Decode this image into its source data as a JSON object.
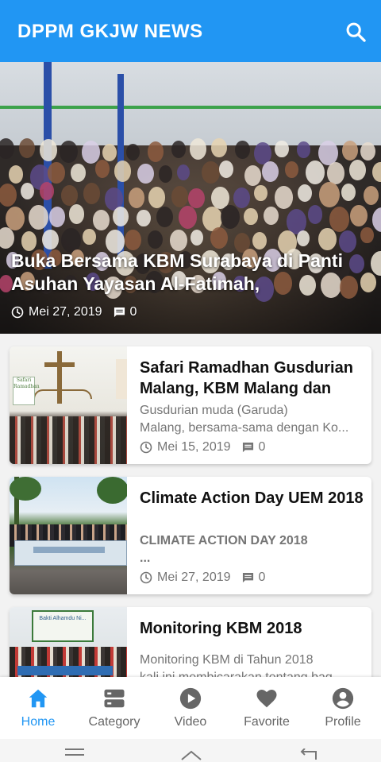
{
  "app": {
    "title": "DPPM GKJW NEWS",
    "search_icon": "search-icon"
  },
  "featured": {
    "title": "Buka Bersama KBM Surabaya di Panti Asuhan Yayasan Al-Fatimah,",
    "date": "Mei 27, 2019",
    "comments": "0"
  },
  "articles": [
    {
      "title": "Safari Ramadhan Gusdurian Malang, KBM Malang dan",
      "desc_line1": "Gusdurian muda (Garuda)",
      "desc_line2": "Malang, bersama-sama dengan Ko...",
      "date": "Mei 15, 2019",
      "comments": "0",
      "thumb_text": "Safari Ramadhan"
    },
    {
      "title": "Climate Action Day UEM 2018",
      "desc_line1": "CLIMATE ACTION DAY 2018",
      "desc_line2": "...",
      "date": "Mei 27, 2019",
      "comments": "0"
    },
    {
      "title": "Monitoring KBM 2018",
      "desc_line1": "Monitoring KBM di Tahun 2018",
      "desc_line2": "kali ini membicarakan tentang bag",
      "thumb_text": "Bakti Alhamdu Ni..."
    }
  ],
  "nav": [
    {
      "label": "Home",
      "icon": "home-icon",
      "active": true
    },
    {
      "label": "Category",
      "icon": "category-icon"
    },
    {
      "label": "Video",
      "icon": "video-icon"
    },
    {
      "label": "Favorite",
      "icon": "favorite-icon"
    },
    {
      "label": "Profile",
      "icon": "profile-icon"
    }
  ],
  "colors": {
    "primary": "#2196f3",
    "inactive": "#666666"
  }
}
